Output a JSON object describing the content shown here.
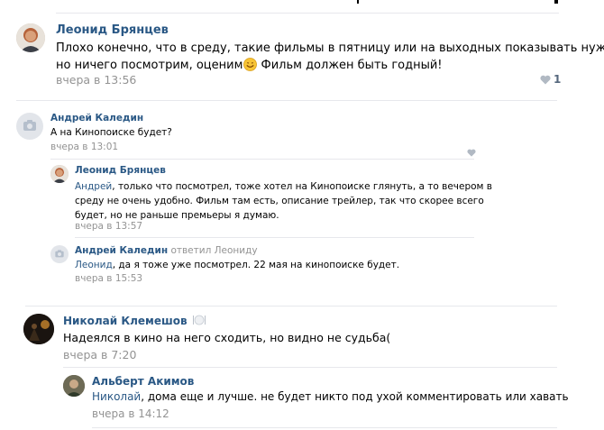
{
  "comments": [
    {
      "author": "Леонид Брянцев",
      "text_before_emoji": "Плохо конечно, что в среду, такие фильмы в пятницу или на выходных показывать нужно,",
      "text_line2": "но ничего посмотрим, оценим",
      "text_after_emoji": " Фильм должен быть годный!",
      "emoji": "smiling-face-emoji",
      "time": "вчера в 13:56",
      "likes": "1"
    },
    {
      "author": "Андрей Каледин",
      "text": "А на Кинопоиске будет?",
      "time": "вчера в 13:01",
      "replies": [
        {
          "author": "Леонид Брянцев",
          "mention": "Андрей",
          "line1": ", только что посмотрел, тоже хотел на Кинопоиске глянуть, а то вечером в",
          "line2": "среду не очень удобно. Фильм там есть, описание трейлер, так что скорее всего",
          "line3": "будет, но не раньше премьеры я думаю.",
          "time": "вчера в 13:57"
        },
        {
          "author": "Андрей Каледин",
          "replied_to": "ответил Леониду",
          "mention": "Леонид",
          "text": ", да я тоже уже посмотрел. 22 мая на кинопоиске будет.",
          "time": "вчера в 15:53"
        }
      ]
    },
    {
      "author": "Николай Клемешов",
      "text": "Надеялся в кино на него сходить, но видно не судьба(",
      "time": "вчера в 7:20",
      "replies": [
        {
          "author": "Альберт Акимов",
          "mention": "Николай",
          "text": ", дома еще и лучше. не будет никто под ухой комментировать или хавать",
          "time": "вчера в 14:12"
        }
      ]
    }
  ]
}
